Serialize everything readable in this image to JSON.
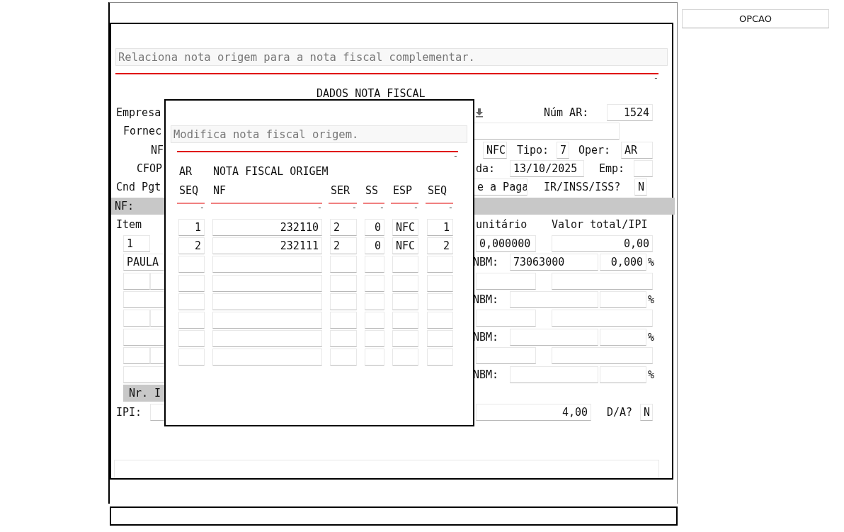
{
  "option_button": "OPCAO",
  "form": {
    "message": "Relaciona nota origem para a nota fiscal complementar.",
    "rule_mark": "-",
    "title": "DADOS NOTA FISCAL",
    "rows": [
      {
        "items": [
          {
            "kind": "label",
            "text": "Empresa"
          },
          {
            "kind": "icon"
          },
          {
            "kind": "label",
            "text": "Núm AR:"
          },
          {
            "kind": "field",
            "value": "1524"
          }
        ]
      },
      {
        "items": [
          {
            "kind": "label",
            "text": "Fornec"
          },
          {
            "kind": "field"
          }
        ]
      },
      {
        "items": [
          {
            "kind": "label",
            "text": "NF"
          },
          {
            "kind": "field",
            "value": "NFC"
          },
          {
            "kind": "label",
            "text": "Tipo:"
          },
          {
            "kind": "field",
            "value": "7"
          },
          {
            "kind": "label",
            "text": "Oper:"
          },
          {
            "kind": "field",
            "value": "AR"
          }
        ]
      },
      {
        "items": [
          {
            "kind": "label",
            "text": "CFOP"
          },
          {
            "kind": "label",
            "text": "da:"
          },
          {
            "kind": "field",
            "value": "13/10/2025"
          },
          {
            "kind": "label",
            "text": "Emp:"
          },
          {
            "kind": "field"
          }
        ]
      },
      {
        "items": [
          {
            "kind": "label",
            "text": "Cnd Pgt"
          },
          {
            "kind": "field",
            "value": "e a Paga"
          },
          {
            "kind": "label",
            "text": "IR/INSS/ISS?"
          },
          {
            "kind": "field",
            "value": "N"
          }
        ]
      },
      {
        "items": [
          {
            "kind": "band",
            "text": "NF:"
          }
        ]
      },
      {
        "items": [
          {
            "kind": "label",
            "text": "Item"
          },
          {
            "kind": "label",
            "text": "unitário"
          },
          {
            "kind": "label",
            "text": "Valor total/IPI"
          }
        ]
      },
      {
        "items": [
          {
            "kind": "field",
            "value": "1"
          },
          {
            "kind": "field",
            "value": "0,000000"
          },
          {
            "kind": "field",
            "value": "0,00"
          }
        ]
      },
      {
        "items": [
          {
            "kind": "field",
            "value": "PAULA"
          },
          {
            "kind": "label",
            "text": "NBM:"
          },
          {
            "kind": "field",
            "value": "73063000"
          },
          {
            "kind": "field",
            "value": "0,000"
          },
          {
            "kind": "label",
            "text": "%"
          }
        ]
      },
      {
        "items": [
          {
            "kind": "field"
          },
          {
            "kind": "field"
          },
          {
            "kind": "field"
          },
          {
            "kind": "field"
          }
        ]
      },
      {
        "items": [
          {
            "kind": "field"
          },
          {
            "kind": "label",
            "text": "NBM:"
          },
          {
            "kind": "field"
          },
          {
            "kind": "field"
          },
          {
            "kind": "label",
            "text": "%"
          }
        ]
      },
      {
        "items": [
          {
            "kind": "field"
          },
          {
            "kind": "field"
          },
          {
            "kind": "field"
          },
          {
            "kind": "field"
          }
        ]
      },
      {
        "items": [
          {
            "kind": "field"
          },
          {
            "kind": "label",
            "text": "NBM:"
          },
          {
            "kind": "field"
          },
          {
            "kind": "field"
          },
          {
            "kind": "label",
            "text": "%"
          }
        ]
      },
      {
        "items": [
          {
            "kind": "field"
          },
          {
            "kind": "field"
          },
          {
            "kind": "field"
          },
          {
            "kind": "field"
          }
        ]
      },
      {
        "items": [
          {
            "kind": "field"
          },
          {
            "kind": "label",
            "text": "NBM:"
          },
          {
            "kind": "field"
          },
          {
            "kind": "field"
          },
          {
            "kind": "label",
            "text": "%"
          }
        ]
      },
      {
        "items": [
          {
            "kind": "band",
            "text": "Nr. I"
          }
        ]
      },
      {
        "items": [
          {
            "kind": "label",
            "text": "IPI:"
          },
          {
            "kind": "field"
          },
          {
            "kind": "field",
            "value": "4,00"
          },
          {
            "kind": "label",
            "text": "D/A?"
          },
          {
            "kind": "field",
            "value": "N"
          }
        ]
      }
    ]
  },
  "dialog": {
    "message": "Modifica nota fiscal origem.",
    "rule_mark": "-",
    "group_headers": [
      "AR",
      "NOTA FISCAL ORIGEM"
    ],
    "columns": [
      {
        "label": "SEQ",
        "mark": "-"
      },
      {
        "label": "NF",
        "mark": "-"
      },
      {
        "label": "SER",
        "mark": "-"
      },
      {
        "label": "SS",
        "mark": "-"
      },
      {
        "label": "ESP",
        "mark": "-"
      },
      {
        "label": "SEQ",
        "mark": "-"
      }
    ],
    "rows": [
      {
        "cells": [
          "1",
          "232110",
          "2",
          "0",
          "NFC",
          "1"
        ]
      },
      {
        "cells": [
          "2",
          "232111",
          "2",
          "0",
          "NFC",
          "2"
        ]
      },
      {},
      {},
      {},
      {},
      {},
      {}
    ]
  }
}
